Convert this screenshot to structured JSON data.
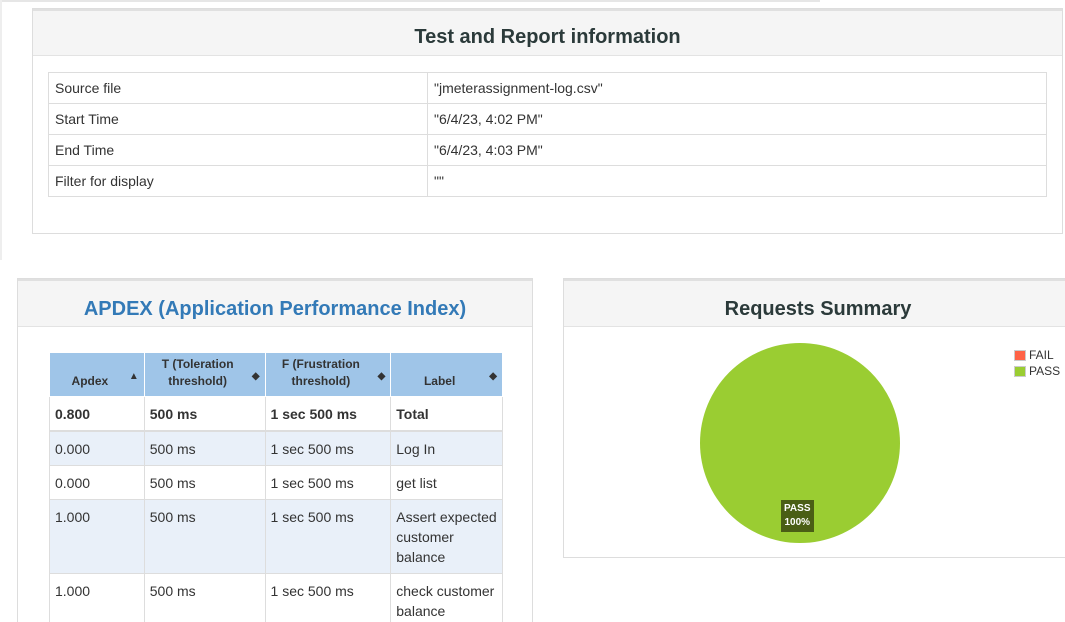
{
  "info": {
    "title": "Test and Report information",
    "rows": [
      {
        "key": "Source file",
        "value": "\"jmeterassignment-log.csv\""
      },
      {
        "key": "Start Time",
        "value": "\"6/4/23, 4:02 PM\""
      },
      {
        "key": "End Time",
        "value": "\"6/4/23, 4:03 PM\""
      },
      {
        "key": "Filter for display",
        "value": "\"\""
      }
    ]
  },
  "apdex": {
    "title": "APDEX (Application Performance Index)",
    "headers": {
      "apdex": "Apdex",
      "t_line1": "T (Toleration",
      "t_line2": "threshold)",
      "f_line1": "F (Frustration",
      "f_line2": "threshold)",
      "label": "Label"
    },
    "sort_icons": {
      "apdex": "▲",
      "t": "◆",
      "f": "◆",
      "label": "◆"
    },
    "rows": [
      {
        "apdex": "0.800",
        "t": "500 ms",
        "f": "1 sec 500 ms",
        "label": "Total"
      },
      {
        "apdex": "0.000",
        "t": "500 ms",
        "f": "1 sec 500 ms",
        "label": "Log In"
      },
      {
        "apdex": "0.000",
        "t": "500 ms",
        "f": "1 sec 500 ms",
        "label": "get list"
      },
      {
        "apdex": "1.000",
        "t": "500 ms",
        "f": "1 sec 500 ms",
        "label": "Assert expected customer balance"
      },
      {
        "apdex": "1.000",
        "t": "500 ms",
        "f": "1 sec 500 ms",
        "label": "check customer balance"
      }
    ]
  },
  "summary": {
    "title": "Requests Summary",
    "legend": [
      {
        "name": "FAIL",
        "color": "#ff6347"
      },
      {
        "name": "PASS",
        "color": "#9acd32"
      }
    ],
    "pie_label_name": "PASS",
    "pie_label_pct": "100%",
    "chart_data": {
      "type": "pie",
      "series": [
        {
          "name": "FAIL",
          "value": 0,
          "color": "#ff6347"
        },
        {
          "name": "PASS",
          "value": 100,
          "color": "#9acd32"
        }
      ]
    }
  }
}
